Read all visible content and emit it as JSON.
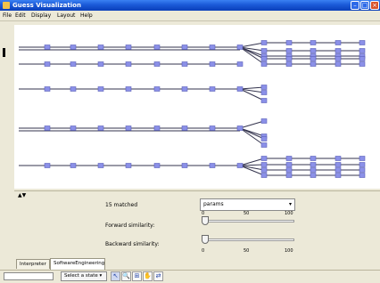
{
  "window": {
    "title": "Guess Visualization",
    "title_bar_color": "#1b5ad8",
    "controls": {
      "minimize": "–",
      "maximize": "□",
      "close": "×"
    }
  },
  "menu": [
    "File",
    "Edit",
    "Display",
    "Layout",
    "Help"
  ],
  "graph": {
    "node_color": "#8b90e8",
    "edge_color": "#33334d",
    "collapse_indicator": "▲▼"
  },
  "panel": {
    "matched_text": "15 matched",
    "dropdown_value": "params",
    "forward_label": "Forward similarity:",
    "backward_label": "Backward similarity:",
    "slider_ticks": [
      "0",
      "50",
      "100"
    ],
    "forward_value": 0,
    "backward_value": 0
  },
  "tabs": [
    "Interpreter",
    "SoftwareEngineering"
  ],
  "status": {
    "state_select": "Select a state ▾",
    "tools": [
      "pointer-icon",
      "zoom-icon",
      "select-icon",
      "hand-icon",
      "layout-icon"
    ],
    "tool_glyphs": [
      "↖",
      "🔍",
      "⊞",
      "✋",
      "⇄"
    ]
  }
}
